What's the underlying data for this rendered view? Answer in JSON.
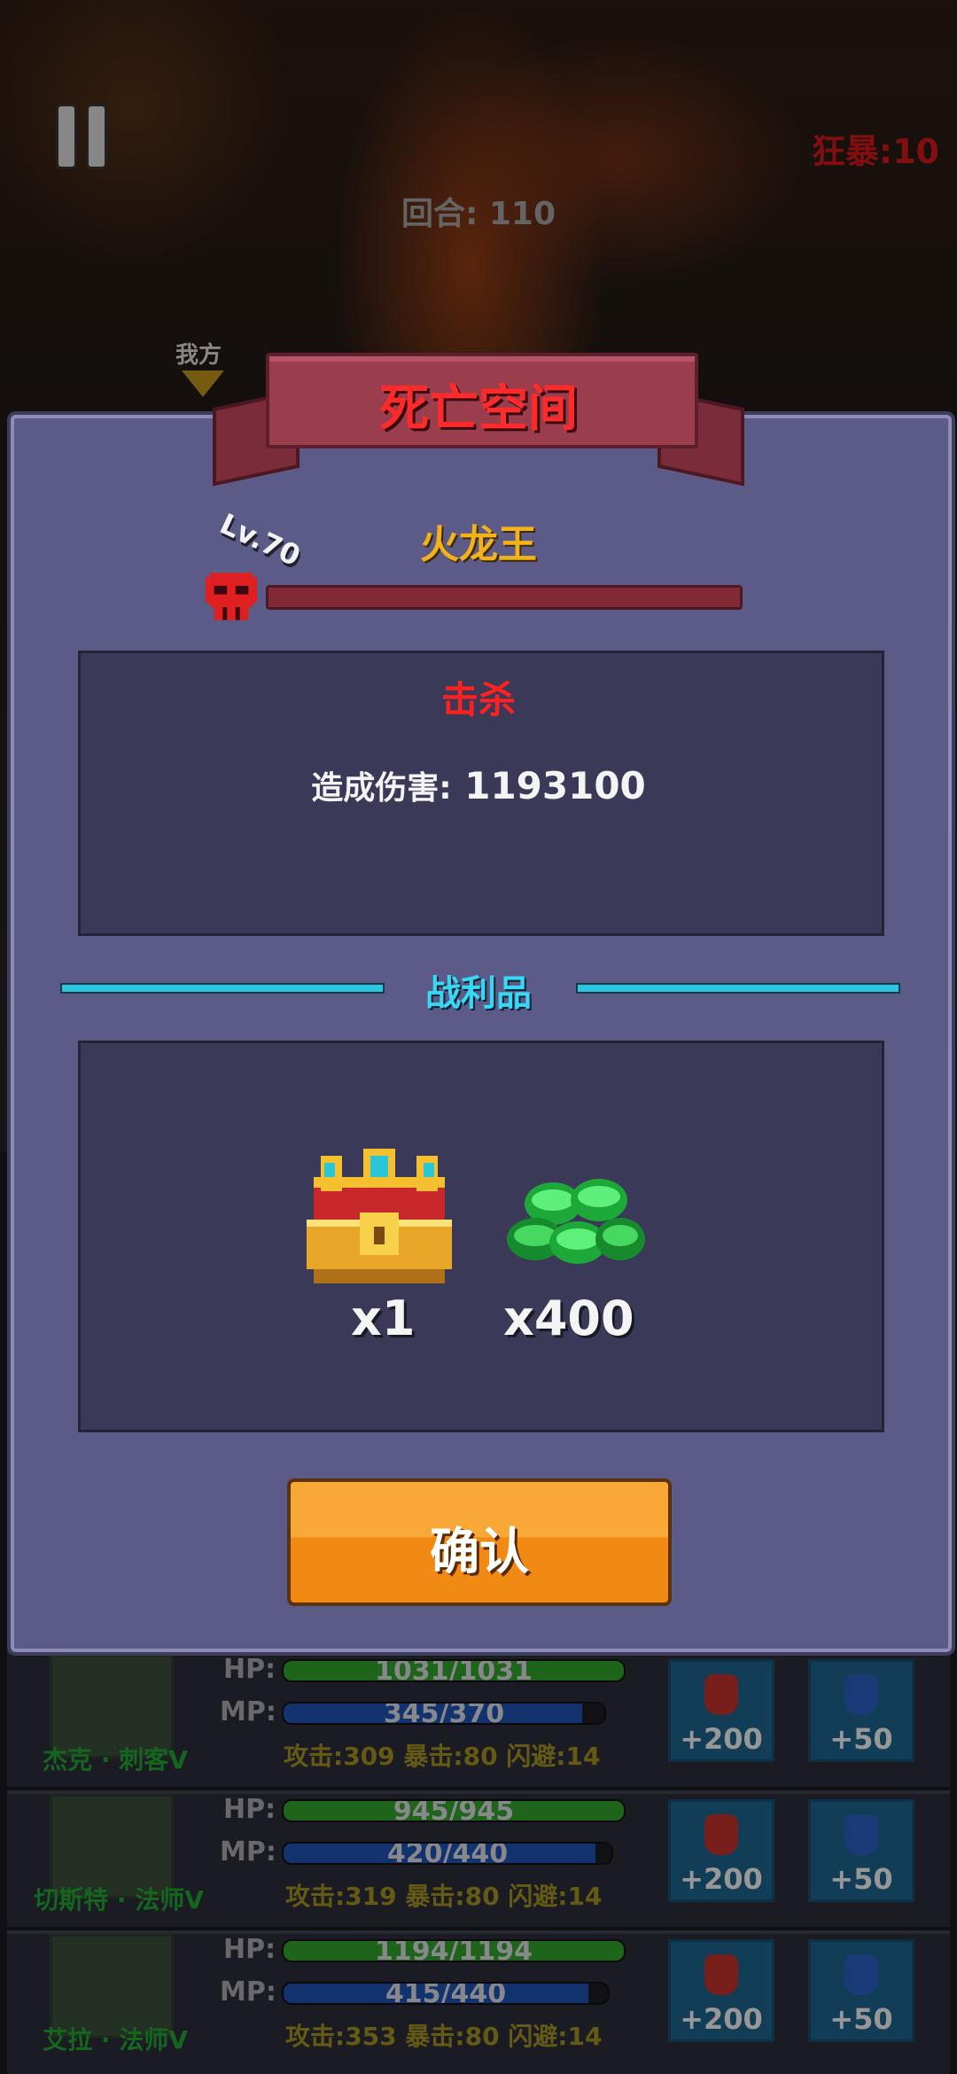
{
  "hud": {
    "rage_label": "狂暴:10",
    "round_label": "回合: 110",
    "ours_label": "我方"
  },
  "modal": {
    "title": "死亡空间",
    "boss_level": "Lv.70",
    "boss_name": "火龙王",
    "result": "击杀",
    "damage_label": "造成伤害:",
    "damage_value": "1193100",
    "loot_title": "战利品",
    "loot": [
      {
        "icon": "treasure-chest-icon",
        "count": "x1"
      },
      {
        "icon": "green-gem-pile-icon",
        "count": "x400"
      }
    ],
    "confirm_label": "确认"
  },
  "party": [
    {
      "name": "杰克 · 刺客V",
      "hp_label": "HP:",
      "hp": "1031/1031",
      "hp_ratio": 1.0,
      "mp_label": "MP:",
      "mp": "345/370",
      "mp_ratio": 0.93,
      "stats": "攻击:309  暴击:80  闪避:14",
      "hp_potion": "+200",
      "mp_potion": "+50"
    },
    {
      "name": "切斯特 · 法师V",
      "hp_label": "HP:",
      "hp": "945/945",
      "hp_ratio": 1.0,
      "mp_label": "MP:",
      "mp": "420/440",
      "mp_ratio": 0.95,
      "stats": "攻击:319  暴击:80  闪避:14",
      "hp_potion": "+200",
      "mp_potion": "+50"
    },
    {
      "name": "艾拉 · 法师V",
      "hp_label": "HP:",
      "hp": "1194/1194",
      "hp_ratio": 1.0,
      "mp_label": "MP:",
      "mp": "415/440",
      "mp_ratio": 0.94,
      "stats": "攻击:353  暴击:80  闪避:14",
      "hp_potion": "+200",
      "mp_potion": "+50"
    }
  ],
  "colors": {
    "panel": "#5c5b88",
    "rage": "#c81818",
    "boss_name": "#f3b21c",
    "kill": "#ff2020",
    "loot_title": "#36d8f4",
    "confirm": "#f8a836",
    "hp_bar": "#2f9a2a",
    "mp_bar": "#1c4fa8"
  }
}
